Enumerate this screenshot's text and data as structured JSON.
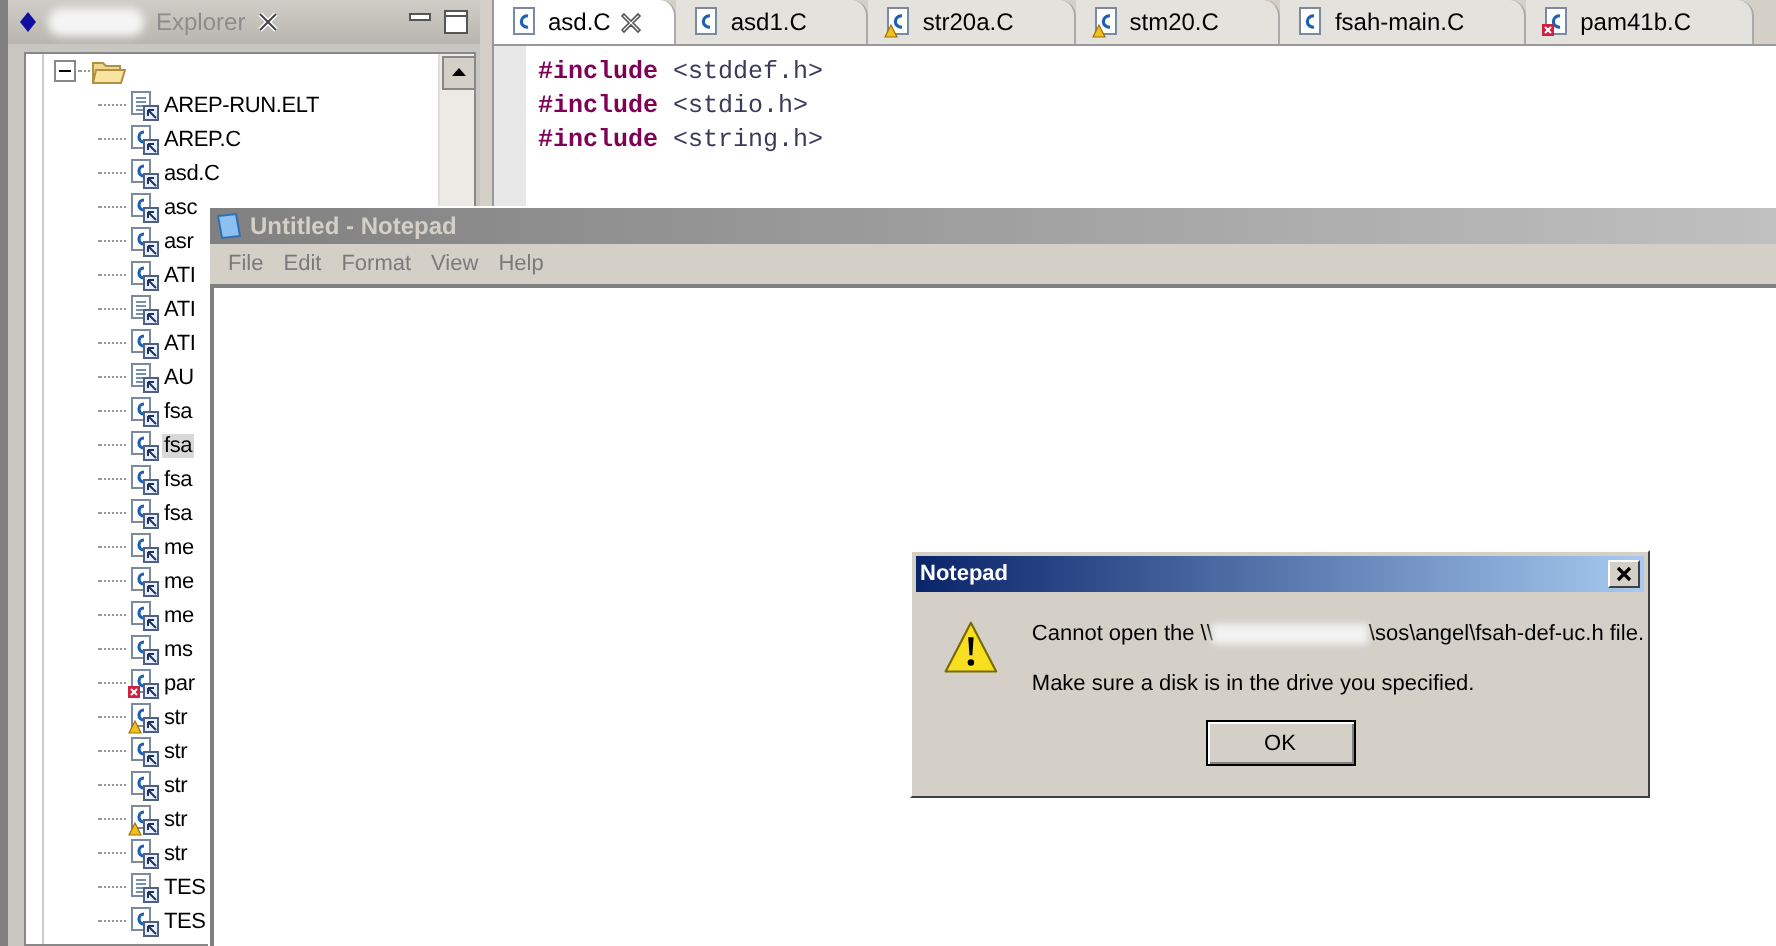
{
  "explorer": {
    "title": "Explorer",
    "tree": [
      {
        "expanded": true,
        "children": [
          {
            "label": "AREP-RUN.ELT",
            "kind": "text",
            "selected": false,
            "warning": false,
            "error": false
          },
          {
            "label": "AREP.C",
            "kind": "c",
            "selected": false,
            "warning": false,
            "error": false
          },
          {
            "label": "asd.C",
            "kind": "c",
            "selected": false,
            "warning": false,
            "error": false
          },
          {
            "label": "asc",
            "kind": "c",
            "selected": false,
            "warning": false,
            "error": false
          },
          {
            "label": "asr",
            "kind": "c",
            "selected": false,
            "warning": false,
            "error": false
          },
          {
            "label": "ATI",
            "kind": "c",
            "selected": false,
            "warning": false,
            "error": false
          },
          {
            "label": "ATI",
            "kind": "text",
            "selected": false,
            "warning": false,
            "error": false
          },
          {
            "label": "ATI",
            "kind": "c",
            "selected": false,
            "warning": false,
            "error": false
          },
          {
            "label": "AU",
            "kind": "text",
            "selected": false,
            "warning": false,
            "error": false
          },
          {
            "label": "fsa",
            "kind": "c",
            "selected": false,
            "warning": false,
            "error": false
          },
          {
            "label": "fsa",
            "kind": "c",
            "selected": true,
            "warning": false,
            "error": false
          },
          {
            "label": "fsa",
            "kind": "c",
            "selected": false,
            "warning": false,
            "error": false
          },
          {
            "label": "fsa",
            "kind": "c",
            "selected": false,
            "warning": false,
            "error": false
          },
          {
            "label": "me",
            "kind": "c",
            "selected": false,
            "warning": false,
            "error": false
          },
          {
            "label": "me",
            "kind": "c",
            "selected": false,
            "warning": false,
            "error": false
          },
          {
            "label": "me",
            "kind": "c",
            "selected": false,
            "warning": false,
            "error": false
          },
          {
            "label": "ms",
            "kind": "c",
            "selected": false,
            "warning": false,
            "error": false
          },
          {
            "label": "par",
            "kind": "c",
            "selected": false,
            "warning": false,
            "error": true
          },
          {
            "label": "str",
            "kind": "c",
            "selected": false,
            "warning": true,
            "error": false
          },
          {
            "label": "str",
            "kind": "c",
            "selected": false,
            "warning": false,
            "error": false
          },
          {
            "label": "str",
            "kind": "c",
            "selected": false,
            "warning": false,
            "error": false
          },
          {
            "label": "str",
            "kind": "c",
            "selected": false,
            "warning": true,
            "error": false
          },
          {
            "label": "str",
            "kind": "c",
            "selected": false,
            "warning": false,
            "error": false
          },
          {
            "label": "TES",
            "kind": "text",
            "selected": false,
            "warning": false,
            "error": false
          },
          {
            "label": "TES",
            "kind": "c",
            "selected": false,
            "warning": false,
            "error": false
          }
        ]
      }
    ]
  },
  "editor": {
    "tabs": [
      {
        "label": "asd.C",
        "selected": true,
        "warning": false,
        "error": false
      },
      {
        "label": "asd1.C",
        "selected": false,
        "warning": false,
        "error": false
      },
      {
        "label": "str20a.C",
        "selected": false,
        "warning": true,
        "error": false
      },
      {
        "label": "stm20.C",
        "selected": false,
        "warning": true,
        "error": false
      },
      {
        "label": "fsah-main.C",
        "selected": false,
        "warning": false,
        "error": false
      },
      {
        "label": "pam41b.C",
        "selected": false,
        "warning": false,
        "error": true
      }
    ],
    "code": [
      {
        "keyword": "#include",
        "rest": "<stddef.h>"
      },
      {
        "keyword": "#include",
        "rest": "<stdio.h>"
      },
      {
        "keyword": "#include",
        "rest": "<string.h>"
      }
    ]
  },
  "notepad": {
    "title": "Untitled - Notepad",
    "active": false,
    "menu": [
      "File",
      "Edit",
      "Format",
      "View",
      "Help"
    ]
  },
  "dialog": {
    "title": "Notepad",
    "active": true,
    "message_start": "Cannot open the \\\\",
    "message_end": "\\sos\\angel\\fsah-def-uc.h file.",
    "hint": "Make sure a disk is in the drive you specified.",
    "button": "OK"
  }
}
